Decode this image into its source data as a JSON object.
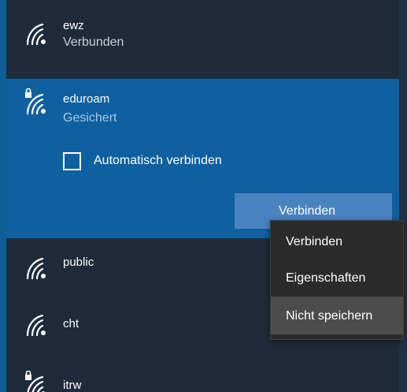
{
  "networks": [
    {
      "name": "ewz",
      "status": "Verbunden",
      "secured": false,
      "selected": false,
      "icon": "wifi-icon"
    },
    {
      "name": "eduroam",
      "status": "Gesichert",
      "secured": true,
      "selected": true,
      "icon": "wifi-secured-icon",
      "auto_connect_label": "Automatisch verbinden",
      "auto_connect_checked": false,
      "connect_button_label": "Verbinden"
    },
    {
      "name": "public",
      "status": "",
      "secured": false,
      "selected": false,
      "icon": "wifi-icon"
    },
    {
      "name": "cht",
      "status": "",
      "secured": false,
      "selected": false,
      "icon": "wifi-icon"
    },
    {
      "name": "itrw",
      "status": "",
      "secured": true,
      "selected": false,
      "icon": "wifi-secured-icon"
    }
  ],
  "context_menu": {
    "items": [
      {
        "label": "Verbinden"
      },
      {
        "label": "Eigenschaften"
      },
      {
        "label": "Nicht speichern",
        "highlighted": true
      }
    ]
  },
  "colors": {
    "background": "#1f2b3a",
    "selected_background": "#0e60a0",
    "button_background": "#4a84c0",
    "menu_background": "#2b2b2b",
    "menu_hover": "#4c4c4c"
  }
}
